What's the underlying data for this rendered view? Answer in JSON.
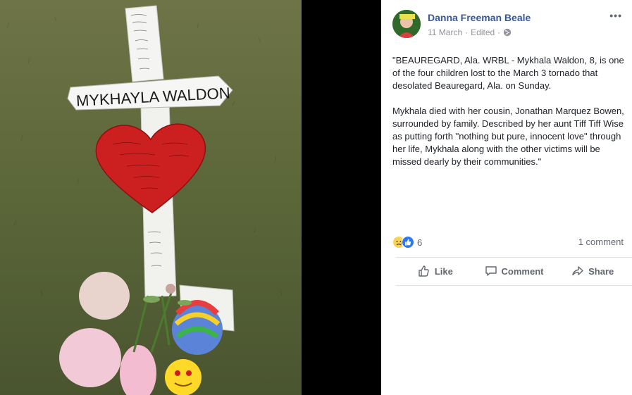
{
  "cross": {
    "name": "MYKHAYLA WALDON"
  },
  "post": {
    "author": "Danna Freeman Beale",
    "date": "11 March",
    "edited": "Edited",
    "separator": "·",
    "paragraphs": [
      "\"BEAUREGARD, Ala. WRBL - Mykhala Waldon, 8, is one of the four children lost to the March 3 tornado that desolated Beauregard, Ala. on Sunday.",
      "Mykhala died with her cousin, Jonathan Marquez Bowen, surrounded by family. Described by her aunt Tiff Tiff Wise as putting forth \"nothing but pure, innocent love\" through her life, Mykhala along with the other victims will be missed dearly by their communities.\""
    ],
    "reaction_count": "6",
    "comment_count": "1 comment",
    "reaction_icons": [
      "sad-reaction-icon",
      "like-reaction-icon"
    ]
  },
  "actions": {
    "like": "Like",
    "comment": "Comment",
    "share": "Share"
  },
  "colors": {
    "link": "#385898",
    "heart": "#cc1f1f",
    "grass": "#5f6b3a"
  }
}
